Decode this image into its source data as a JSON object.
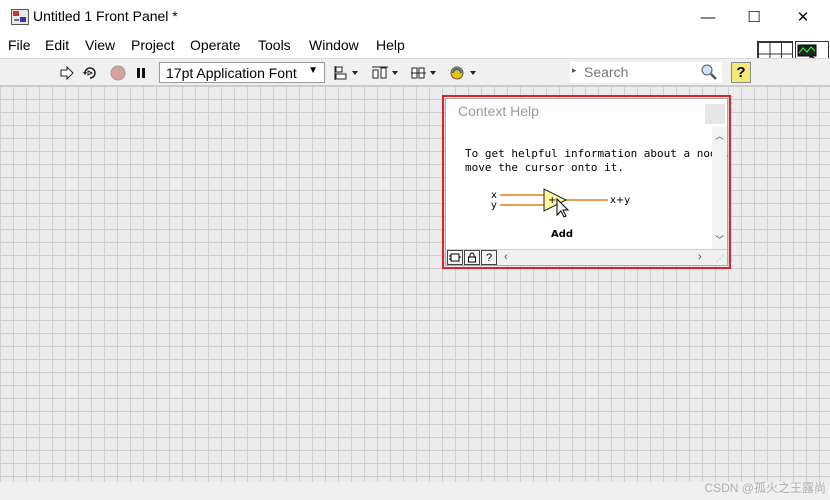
{
  "window": {
    "title": "Untitled 1 Front Panel *",
    "minimize_glyph": "—",
    "maximize_glyph": "☐",
    "close_glyph": "✕"
  },
  "menu": [
    "File",
    "Edit",
    "View",
    "Project",
    "Operate",
    "Tools",
    "Window",
    "Help"
  ],
  "toolbar": {
    "font_select": "17pt Application Font",
    "search_placeholder": "Search",
    "context_help_glyph": "?"
  },
  "icons": {
    "app": "labview-vi-icon",
    "run": "run-arrow-icon",
    "run_continuous": "run-continuously-icon",
    "abort": "abort-execution-icon",
    "pause": "pause-icon",
    "align": "align-objects-icon",
    "distribute": "distribute-objects-icon",
    "resize": "resize-objects-icon",
    "reorder": "reorder-icon",
    "search": "magnifier-icon"
  },
  "context_help": {
    "title": "Context Help",
    "text": "To get helpful information about a node,\nmove the cursor onto it.",
    "node": {
      "input_x": "x",
      "input_y": "y",
      "output": "x+y",
      "name": "Add",
      "plus": "+"
    },
    "buttons": [
      "lock-icon-glyph",
      "?"
    ]
  },
  "watermark": "CSDN @孤火之王露尚",
  "colors": {
    "highlight": "#e0202a",
    "wire_orange": "#e07a1a",
    "node_fill": "#fff5a0",
    "help_yellow": "#f7e87a"
  }
}
